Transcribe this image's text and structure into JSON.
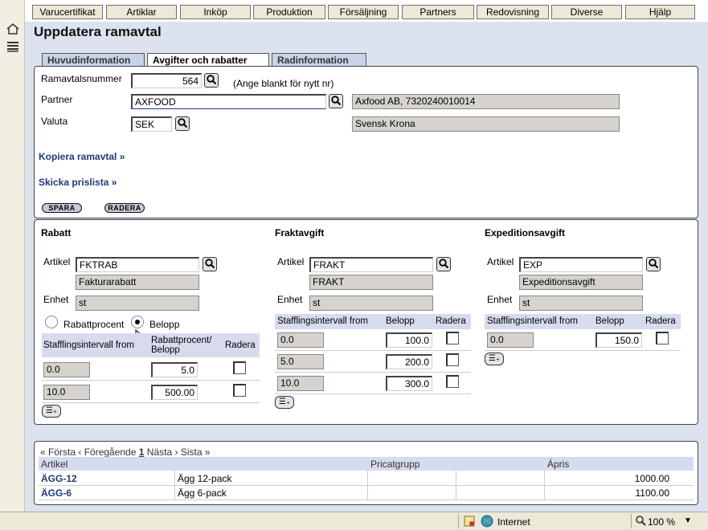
{
  "menu": [
    "Varucertifikat",
    "Artiklar",
    "Inköp",
    "Produktion",
    "Försäljning",
    "Partners",
    "Redovisning",
    "Diverse",
    "Hjälp"
  ],
  "page_title": "Uppdatera ramavtal",
  "tabs": [
    "Huvudinformation",
    "Avgifter och rabatter",
    "Radinformation"
  ],
  "head": {
    "ramavtal_label": "Ramavtalsnummer",
    "ramavtal_value": "564",
    "ramavtal_hint": "(Ange blankt för nytt nr)",
    "partner_label": "Partner",
    "partner_value": "AXFOOD",
    "partner_name": "Axfood AB, 7320240010014",
    "valuta_label": "Valuta",
    "valuta_value": "SEK",
    "valuta_name": "Svensk Krona",
    "kopiera": "Kopiera ramavtal »",
    "skicka": "Skicka prislista »",
    "spara": "SPARA",
    "radera": "RADERA"
  },
  "rabatt": {
    "title": "Rabatt",
    "artikel_label": "Artikel",
    "artikel": "FKTRAB",
    "artikel_name": "Fakturarabatt",
    "enhet_label": "Enhet",
    "enhet": "st",
    "radio1": "Rabattprocent",
    "radio2": "Belopp",
    "col1": "Stafflingsintervall from",
    "col2": "Rabattprocent/ Belopp",
    "col3": "Radera",
    "rows": [
      {
        "from": "0.0",
        "val": "5.0"
      },
      {
        "from": "10.0",
        "val": "500.00"
      }
    ]
  },
  "frakt": {
    "title": "Fraktavgift",
    "artikel_label": "Artikel",
    "artikel": "FRAKT",
    "artikel_name": "FRAKT",
    "enhet_label": "Enhet",
    "enhet": "st",
    "col1": "Stafflingsintervall from",
    "col2": "Belopp",
    "col3": "Radera",
    "rows": [
      {
        "from": "0.0",
        "val": "100.0"
      },
      {
        "from": "5.0",
        "val": "200.0"
      },
      {
        "from": "10.0",
        "val": "300.0"
      }
    ]
  },
  "exp": {
    "title": "Expeditionsavgift",
    "artikel_label": "Artikel",
    "artikel": "EXP",
    "artikel_name": "Expeditionsavgift",
    "enhet_label": "Enhet",
    "enhet": "st",
    "col1": "Stafflingsintervall from",
    "col2": "Belopp",
    "col3": "Radera",
    "rows": [
      {
        "from": "0.0",
        "val": "150.0"
      }
    ]
  },
  "pager": {
    "first": "« Första",
    "prev": "‹ Föregående",
    "page": "1",
    "next": "Nästa ›",
    "last": "Sista »"
  },
  "grid": {
    "headers": [
      "Artikel",
      "Pricatgrupp",
      "Ápris"
    ],
    "rows": [
      {
        "code": "ÄGG-12",
        "name": "Ägg 12-pack",
        "price": "1000.00"
      },
      {
        "code": "ÄGG-6",
        "name": "Ägg 6-pack",
        "price": "1100.00"
      }
    ]
  },
  "statusbar": {
    "zone": "Internet",
    "zoom": "100 %"
  }
}
